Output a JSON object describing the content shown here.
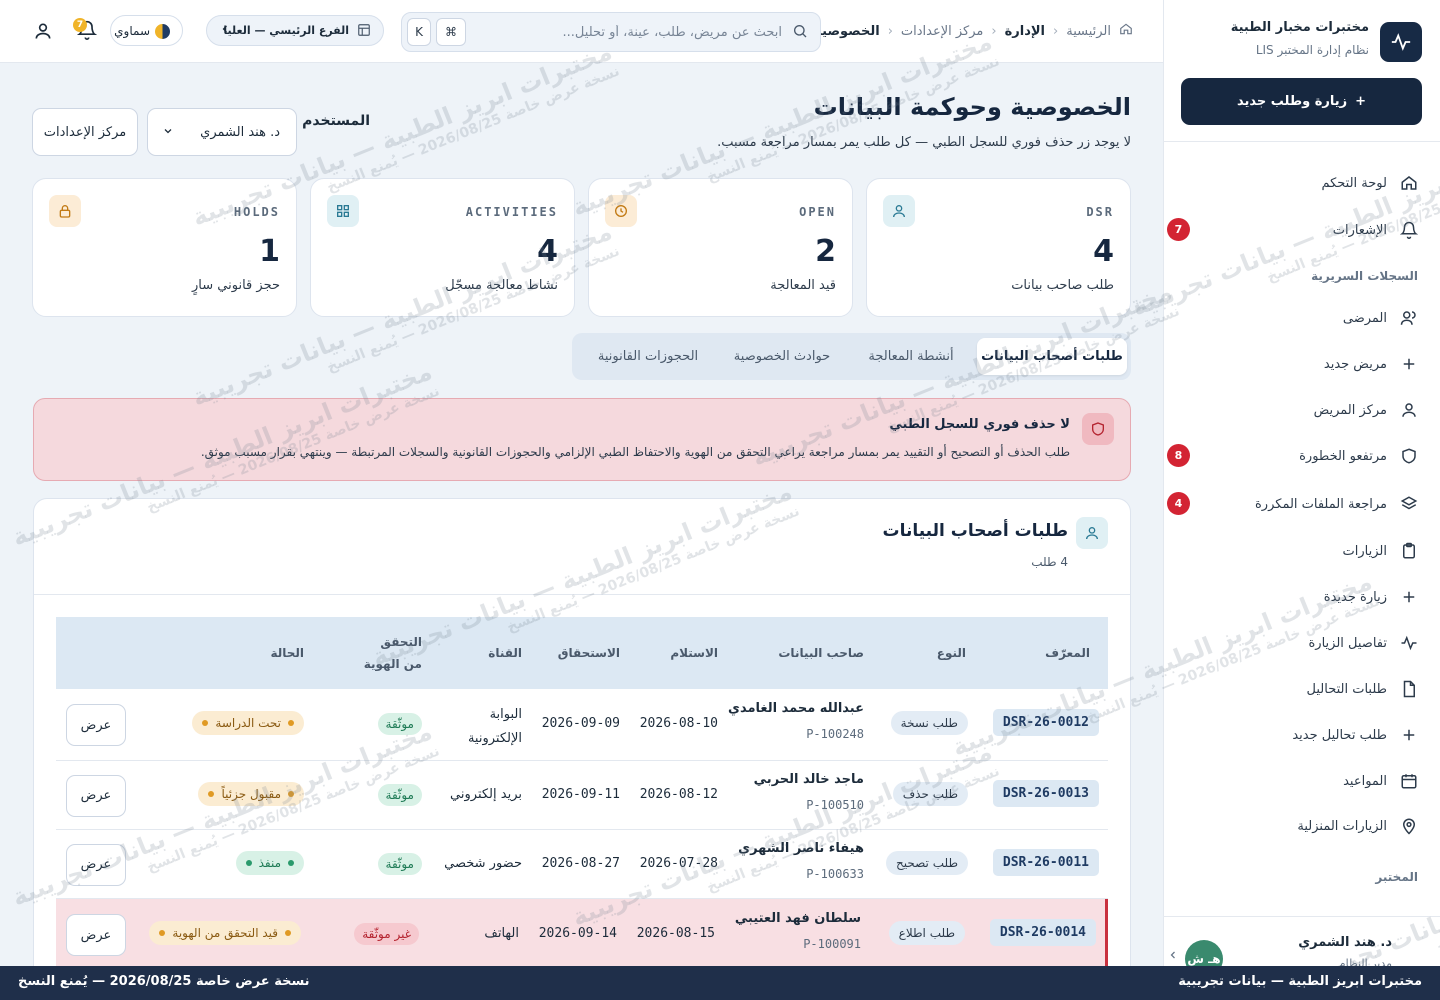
{
  "brand": {
    "name": "مختبرات مخبار الطبية",
    "subtitle": "نظام إدارة المختبر LIS",
    "new_visit": "زيارة وطلب جديد"
  },
  "nav": {
    "items": [
      {
        "label": "لوحة التحكم",
        "icon": "home-icon"
      },
      {
        "label": "الإشعارات",
        "icon": "bell-icon",
        "badge": "7"
      }
    ],
    "section_clinical": "السجلات السريرية",
    "clinical": [
      {
        "label": "المرضى",
        "icon": "users-icon"
      },
      {
        "label": "مريض جديد",
        "icon": "plus-icon"
      },
      {
        "label": "مركز المريض",
        "icon": "user-icon"
      },
      {
        "label": "مرتفعو الخطورة",
        "icon": "shield-icon",
        "badge": "8"
      },
      {
        "label": "مراجعة الملفات المكررة",
        "icon": "layers-icon",
        "badge": "4"
      },
      {
        "label": "الزيارات",
        "icon": "clipboard-icon"
      },
      {
        "label": "زيارة جديدة",
        "icon": "plus-icon"
      },
      {
        "label": "تفاصيل الزيارة",
        "icon": "activity-icon"
      },
      {
        "label": "طلبات التحاليل",
        "icon": "file-icon"
      },
      {
        "label": "طلب تحاليل جديد",
        "icon": "plus-icon"
      },
      {
        "label": "المواعيد",
        "icon": "calendar-icon"
      },
      {
        "label": "الزيارات المنزلية",
        "icon": "map-pin-icon"
      }
    ],
    "section_lab": "المختبر"
  },
  "side_user": {
    "initials": "هـ ش",
    "name": "د. هند الشمري",
    "role": "مدير النظام"
  },
  "topbar": {
    "breadcrumb": [
      "الرئيسية",
      "الإدارة",
      "مركز الإعدادات",
      "الخصوصية"
    ],
    "search_placeholder": "ابحث عن مريض، طلب، عينة، أو تحليل...",
    "kbd_cmd": "⌘",
    "kbd_k": "K",
    "branch": "الفرع الرئيسي — العليا",
    "theme": "سماوي",
    "notif_count": "7"
  },
  "page": {
    "title": "الخصوصية وحوكمة البيانات",
    "subtitle": "لا يوجد زر حذف فوري للسجل الطبي — كل طلب يمر بمسار مراجعة مسبب.",
    "user_label": "المستخدم",
    "user_value": "د. هند الشمري",
    "settings_btn": "مركز الإعدادات"
  },
  "kpis": [
    {
      "code": "DSR",
      "value": "4",
      "label": "طلب صاحب بيانات",
      "icon": "user-icon",
      "color": "#e0f0f4",
      "fg": "#2a7a94"
    },
    {
      "code": "OPEN",
      "value": "2",
      "label": "قيد المعالجة",
      "icon": "clock-icon",
      "color": "#fcecd6",
      "fg": "#c27a14"
    },
    {
      "code": "ACTIVITIES",
      "value": "4",
      "label": "نشاط معالجة مسجّل",
      "icon": "grid-icon",
      "color": "#e0f0f4",
      "fg": "#2a7a94"
    },
    {
      "code": "HOLDS",
      "value": "1",
      "label": "حجز قانوني سارٍ",
      "icon": "lock-icon",
      "color": "#fcecd6",
      "fg": "#c27a14"
    }
  ],
  "tabs": [
    "طلبات أصحاب البيانات",
    "أنشطة المعالجة",
    "حوادث الخصوصية",
    "الحجوزات القانونية"
  ],
  "alert": {
    "title": "لا حذف فوري للسجل الطبي",
    "text": "طلب الحذف أو التصحيح أو التقييد يمر بمسار مراجعة يراعي التحقق من الهوية والاحتفاظ الطبي الإلزامي والحجوزات القانونية والسجلات المرتبطة — وينتهي بقرار مسبب موثق."
  },
  "table": {
    "title": "طلبات أصحاب البيانات",
    "count": "4 طلب",
    "headers": {
      "id": "المعرّف",
      "type": "النوع",
      "subject": "صاحب البيانات",
      "received": "الاستلام",
      "due": "الاستحقاق",
      "channel": "القناة",
      "verify": "التحقق من الهوية",
      "status": "الحالة"
    },
    "view_label": "عرض",
    "rows": [
      {
        "id": "DSR-26-0012",
        "type": "طلب نسخة",
        "name": "عبدالله محمد الغامدي",
        "pid": "P-100248",
        "received": "2026-08-10",
        "due": "2026-09-09",
        "channel": [
          "البوابة",
          "الإلكترونية"
        ],
        "verify": "موثّقة",
        "verify_ok": true,
        "status": "تحت الدراسة",
        "status_kind": "amber",
        "flag": false
      },
      {
        "id": "DSR-26-0013",
        "type": "طلب حذف",
        "name": "ماجد خالد الحربي",
        "pid": "P-100510",
        "received": "2026-08-12",
        "due": "2026-09-11",
        "channel": [
          "بريد إلكتروني"
        ],
        "verify": "موثّقة",
        "verify_ok": true,
        "status": "مقبول جزئياً",
        "status_kind": "amber",
        "flag": false
      },
      {
        "id": "DSR-26-0011",
        "type": "طلب تصحيح",
        "name": "هيفاء ناصر الشهري",
        "pid": "P-100633",
        "received": "2026-07-28",
        "due": "2026-08-27",
        "channel": [
          "حضور شخصي"
        ],
        "verify": "موثّقة",
        "verify_ok": true,
        "status": "منفذ",
        "status_kind": "green",
        "flag": false
      },
      {
        "id": "DSR-26-0014",
        "type": "طلب اطلاع",
        "name": "سلطان فهد العتيبي",
        "pid": "P-100091",
        "received": "2026-08-15",
        "due": "2026-09-14",
        "channel": [
          "الهاتف"
        ],
        "verify": "غير موثّقة",
        "verify_ok": false,
        "status": "قيد التحقق من الهوية",
        "status_kind": "amber",
        "flag": true
      }
    ]
  },
  "footer": {
    "right": "مختبرات ابريز الطبية — بيانات تجريبية",
    "left": "نسخة عرض خاصة 2026/08/25 — يُمنع النسخ"
  },
  "watermark": {
    "line1": "مختبرات ابريز الطبية — بيانات تجريبية",
    "line2": "نسخة عرض خاصة 2026/08/25 — يُمنع النسخ"
  },
  "colors": {
    "navy": "#16273f",
    "danger": "#d32433",
    "accent": "#2a7a94"
  }
}
